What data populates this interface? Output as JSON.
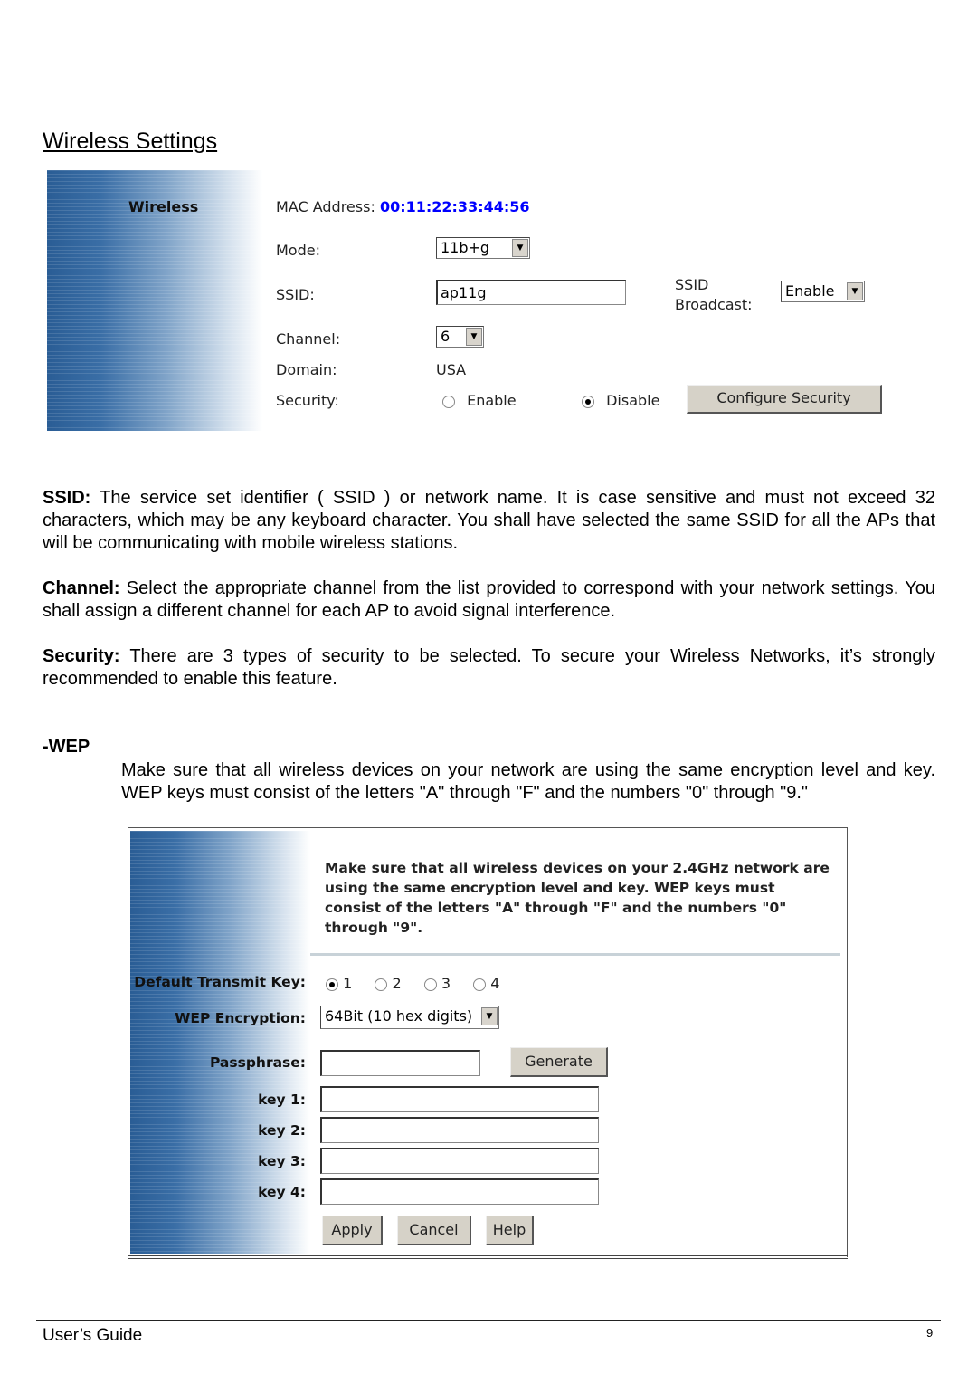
{
  "page_title": "Wireless Settings",
  "wireless_panel": {
    "section_label": "Wireless",
    "mac_label": "MAC Address:",
    "mac_value": "00:11:22:33:44:56",
    "mac_color": "#0000ff",
    "mode_label": "Mode:",
    "mode_value": "11b+g",
    "ssid_label": "SSID:",
    "ssid_value": "ap11g",
    "ssid_broadcast_label_1": "SSID",
    "ssid_broadcast_label_2": "Broadcast:",
    "ssid_broadcast_value": "Enable",
    "channel_label": "Channel:",
    "channel_value": "6",
    "domain_label": "Domain:",
    "domain_value": "USA",
    "security_label": "Security:",
    "security_enable": "Enable",
    "security_disable": "Disable",
    "security_selected": "Disable",
    "configure_button": "Configure Security"
  },
  "paragraphs": {
    "ssid_term": "SSID:",
    "ssid_text": " The service set identifier ( SSID ) or network name. It is case sensitive and must not exceed 32 characters, which may be any keyboard character. You shall have selected the same SSID for all the APs that will be communicating with mobile wireless stations.",
    "channel_term": "Channel:",
    "channel_text": " Select the appropriate channel from the list provided to correspond with your network settings. You shall assign a different channel for each AP to avoid signal interference.",
    "security_term": "Security:",
    "security_text": " There are 3 types of security to be selected. To secure your Wireless Networks, it’s strongly recommended to enable this feature."
  },
  "wep": {
    "heading": "-WEP",
    "description": "Make sure that all wireless devices on your network are using the same encryption level and key. WEP keys must consist of the letters \"A\" through \"F\" and the numbers \"0\" through \"9.\"",
    "panel_note": "Make sure that all wireless devices on your 2.4GHz network are using the same encryption level and key. WEP keys must consist of the letters \"A\" through \"F\" and the numbers \"0\" through \"9\".",
    "default_key_label": "Default Transmit Key:",
    "key_options": [
      "1",
      "2",
      "3",
      "4"
    ],
    "default_key_selected": "1",
    "encryption_label": "WEP Encryption:",
    "encryption_value": "64Bit (10 hex digits)",
    "passphrase_label": "Passphrase:",
    "passphrase_value": "",
    "generate_button": "Generate",
    "key_labels": [
      "key 1:",
      "key 2:",
      "key 3:",
      "key 4:"
    ],
    "key_values": [
      "",
      "",
      "",
      ""
    ],
    "apply_button": "Apply",
    "cancel_button": "Cancel",
    "help_button": "Help"
  },
  "footer": {
    "left": "User’s Guide",
    "page_number": "9"
  }
}
